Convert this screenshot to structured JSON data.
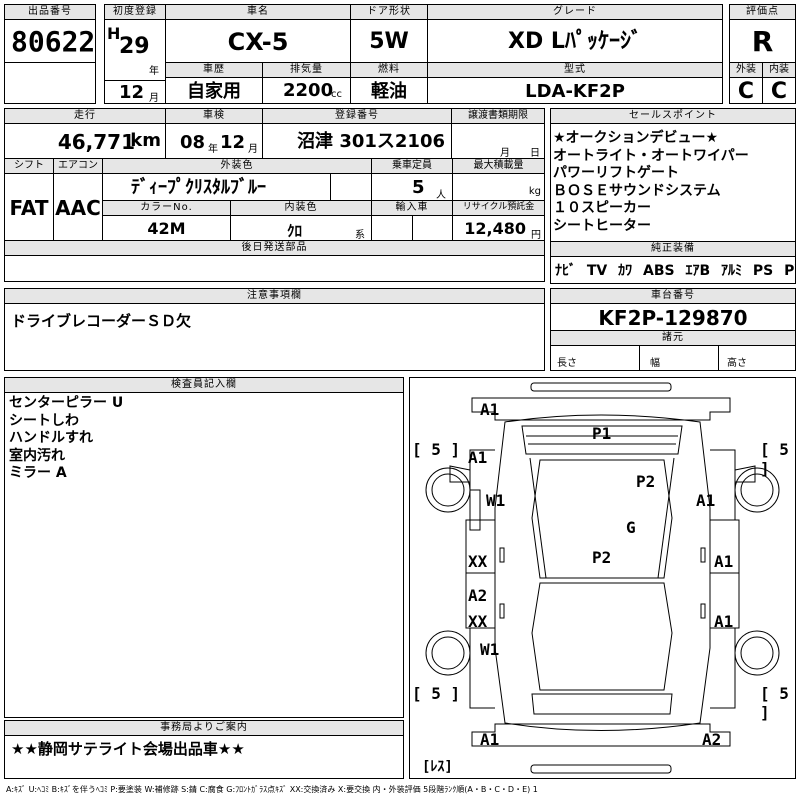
{
  "header": {
    "lot_no_label": "出品番号",
    "lot_no": "80622",
    "first_reg_label": "初度登録",
    "era": "H",
    "first_reg_year": "29",
    "year_unit": "年",
    "first_reg_month": "12",
    "month_unit": "月",
    "car_name_label": "車名",
    "car_name": "CX-5",
    "door_label": "ドア形状",
    "door": "5W",
    "grade_label": "グレード",
    "grade": "XD Lﾊﾟｯｹｰｼﾞ",
    "score_label": "評価点",
    "score": "R",
    "history_label": "車歴",
    "history": "自家用",
    "displacement_label": "排気量",
    "displacement": "2200",
    "displacement_unit": "cc",
    "fuel_label": "燃料",
    "fuel": "軽油",
    "model_label": "型式",
    "model": "LDA-KF2P",
    "exterior_label": "外装",
    "exterior": "C",
    "interior_label": "内装",
    "interior": "C"
  },
  "row2": {
    "mileage_label": "走行",
    "mileage": "46,771",
    "mileage_unit": "km",
    "inspection_label": "車検",
    "inspection_year": "08",
    "inspection_month": "12",
    "year_unit": "年",
    "month_unit": "月",
    "plate_label": "登録番号",
    "plate": "沼津 301ス2106",
    "transfer_label": "譲渡書類期限",
    "transfer_month": "月",
    "transfer_day": "日",
    "shift_label": "シフト",
    "shift": "FAT",
    "ac_label": "エアコン",
    "ac": "AAC",
    "color_label": "外装色",
    "color": "ﾃﾞｨｰﾌﾟｸﾘｽﾀﾙﾌﾞﾙｰ",
    "capacity_label": "乗車定員",
    "capacity": "5",
    "capacity_unit": "人",
    "max_load_label": "最大積載量",
    "max_load_unit": "kg",
    "color_no_label": "カラーNo.",
    "color_no": "42M",
    "interior_color_label": "内装色",
    "interior_color": "ｸﾛ",
    "interior_color_suffix": "系",
    "import_label": "輸入車",
    "recycle_label": "リサイクル預託金",
    "recycle": "12,480",
    "recycle_unit": "円",
    "later_parts_label": "後日発送部品"
  },
  "sales_points": {
    "title": "セールスポイント",
    "lines": [
      "★オークションデビュー★",
      "オートライト・オートワイパー",
      "パワーリフトゲート",
      "ＢＯＳＥサウンドシステム",
      "１０スピーカー",
      "シートヒーター"
    ]
  },
  "equipment": {
    "title": "純正装備",
    "items": [
      "ﾅﾋﾞ",
      "TV",
      "ｶﾜ",
      "ABS",
      "ｴｱB",
      "ｱﾙﾐ",
      "PS",
      "PW"
    ]
  },
  "notes": {
    "title": "注意事項欄",
    "text": "ドライブレコーダーＳＤ欠"
  },
  "chassis": {
    "title": "車台番号",
    "value": "KF2P-129870",
    "spec_title": "諸元",
    "length_label": "長さ",
    "width_label": "幅",
    "height_label": "高さ"
  },
  "inspector": {
    "title": "検査員記入欄",
    "lines": [
      "センターピラー U",
      "シートしわ",
      "ハンドルすれ",
      "室内汚れ",
      "ミラー A"
    ]
  },
  "office": {
    "title": "事務局よりご案内",
    "text": "★★静岡サテライト会場出品車★★"
  },
  "diagram": {
    "bracket_tl": "[ 5 ]",
    "bracket_tr": "[ 5 ]",
    "bracket_bl": "[ 5 ]",
    "bracket_br": "[ 5 ]",
    "rec": "[ﾚｽ]",
    "marks": {
      "a1_top": "A1",
      "p1": "P1",
      "a1_left": "A1",
      "p2_top": "P2",
      "w1_left": "W1",
      "a1_right": "A1",
      "g": "G",
      "xx1": "XX",
      "p2_mid": "P2",
      "a1_mid_r": "A1",
      "a2_left": "A2",
      "xx2": "XX",
      "a1_low_r": "A1",
      "w1_low": "W1",
      "a1_bottom": "A1",
      "a2_bottom": "A2"
    }
  },
  "legend": "A:ｷｽﾞ U:ﾍｺﾐ B:ｷｽﾞを伴うﾍｺﾐ P:要塗装 W:補修跡 S:錆 C:腐食 G:ﾌﾛﾝﾄｶﾞﾗｽ点ｷｽﾞ XX:交換済み X:要交換 内・外装評価 5段階ﾗﾝｸ順(A・B・C・D・E) 1"
}
